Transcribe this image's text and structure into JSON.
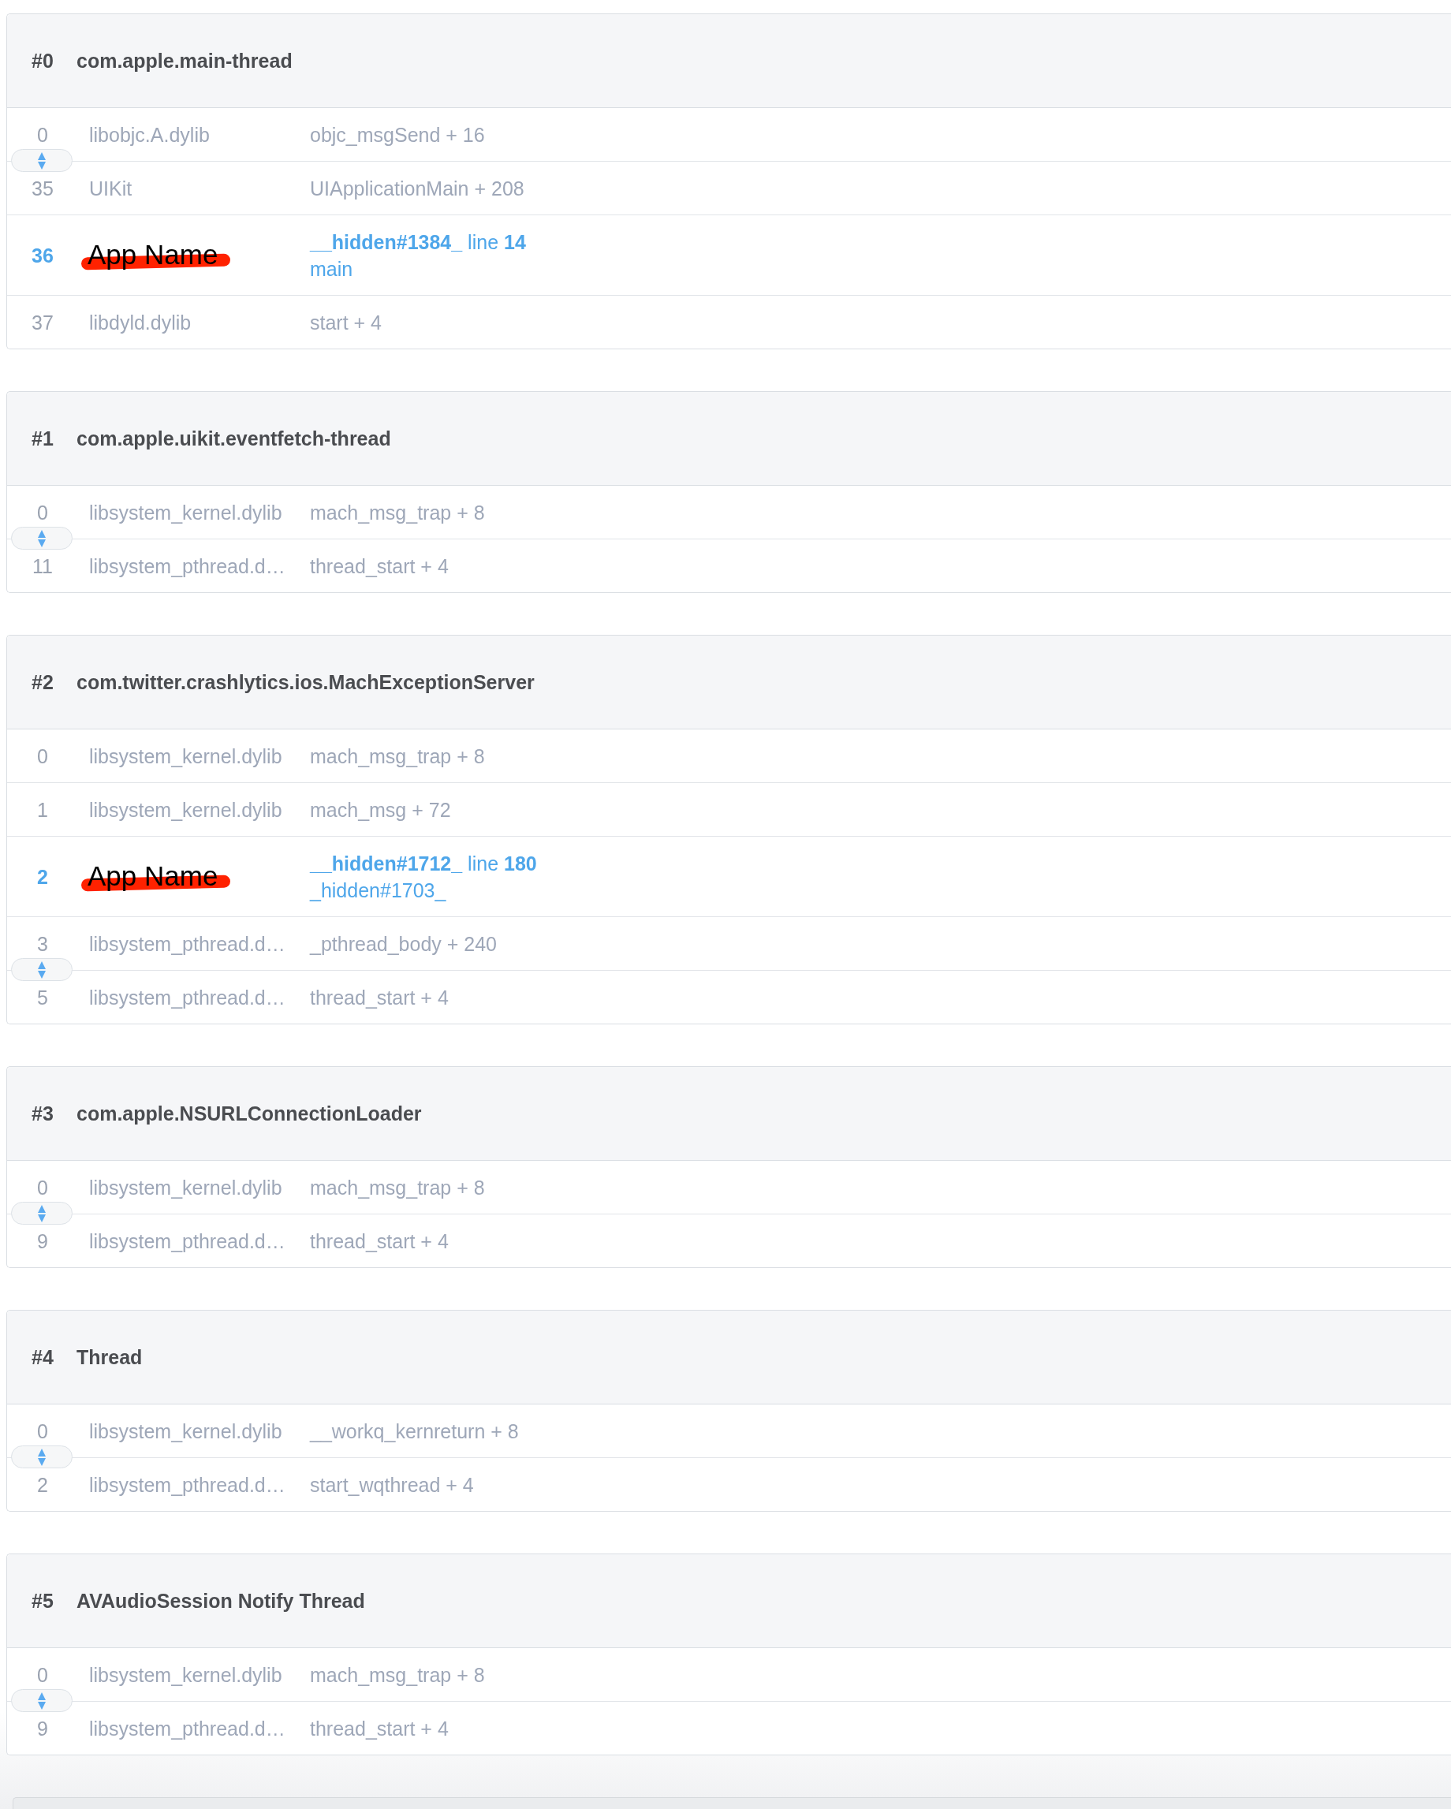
{
  "threads": [
    {
      "index": "#0",
      "name": "com.apple.main-thread",
      "frames": [
        {
          "kind": "system",
          "number": "0",
          "library": "libobjc.A.dylib",
          "symbol": "objc_msgSend + 16",
          "collapsed_before": false
        },
        {
          "kind": "system",
          "number": "35",
          "library": "UIKit",
          "symbol": "UIApplicationMain + 208",
          "collapsed_before": true
        },
        {
          "kind": "app",
          "number": "36",
          "library": "App Name",
          "symbol": "**__hidden#1384_** line **14**",
          "detail": "main",
          "collapsed_before": false
        },
        {
          "kind": "system",
          "number": "37",
          "library": "libdyld.dylib",
          "symbol": "start + 4",
          "collapsed_before": false
        }
      ]
    },
    {
      "index": "#1",
      "name": "com.apple.uikit.eventfetch-thread",
      "frames": [
        {
          "kind": "system",
          "number": "0",
          "library": "libsystem_kernel.dylib",
          "symbol": "mach_msg_trap + 8",
          "collapsed_before": false
        },
        {
          "kind": "system",
          "number": "11",
          "library": "libsystem_pthread.d…",
          "symbol": "thread_start + 4",
          "collapsed_before": true
        }
      ]
    },
    {
      "index": "#2",
      "name": "com.twitter.crashlytics.ios.MachExceptionServer",
      "frames": [
        {
          "kind": "system",
          "number": "0",
          "library": "libsystem_kernel.dylib",
          "symbol": "mach_msg_trap + 8",
          "collapsed_before": false
        },
        {
          "kind": "system",
          "number": "1",
          "library": "libsystem_kernel.dylib",
          "symbol": "mach_msg + 72",
          "collapsed_before": false
        },
        {
          "kind": "app",
          "number": "2",
          "library": "App Name",
          "symbol": "**__hidden#1712_** line **180**",
          "detail": "_hidden#1703_",
          "collapsed_before": false
        },
        {
          "kind": "system",
          "number": "3",
          "library": "libsystem_pthread.d…",
          "symbol": "_pthread_body + 240",
          "collapsed_before": false
        },
        {
          "kind": "system",
          "number": "5",
          "library": "libsystem_pthread.d…",
          "symbol": "thread_start + 4",
          "collapsed_before": true
        }
      ]
    },
    {
      "index": "#3",
      "name": "com.apple.NSURLConnectionLoader",
      "frames": [
        {
          "kind": "system",
          "number": "0",
          "library": "libsystem_kernel.dylib",
          "symbol": "mach_msg_trap + 8",
          "collapsed_before": false
        },
        {
          "kind": "system",
          "number": "9",
          "library": "libsystem_pthread.d…",
          "symbol": "thread_start + 4",
          "collapsed_before": true
        }
      ]
    },
    {
      "index": "#4",
      "name": "Thread",
      "frames": [
        {
          "kind": "system",
          "number": "0",
          "library": "libsystem_kernel.dylib",
          "symbol": "__workq_kernreturn + 8",
          "collapsed_before": false
        },
        {
          "kind": "system",
          "number": "2",
          "library": "libsystem_pthread.d…",
          "symbol": "start_wqthread + 4",
          "collapsed_before": true
        }
      ]
    },
    {
      "index": "#5",
      "name": "AVAudioSession Notify Thread",
      "frames": [
        {
          "kind": "system",
          "number": "0",
          "library": "libsystem_kernel.dylib",
          "symbol": "mach_msg_trap + 8",
          "collapsed_before": false
        },
        {
          "kind": "system",
          "number": "9",
          "library": "libsystem_pthread.d…",
          "symbol": "thread_start + 4",
          "collapsed_before": true
        }
      ]
    }
  ]
}
